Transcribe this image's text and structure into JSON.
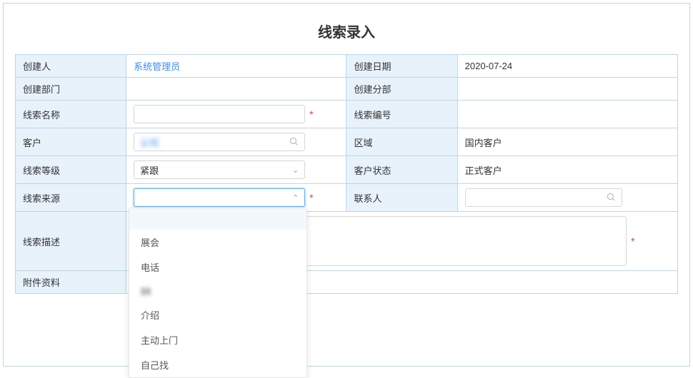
{
  "header": {
    "title": "线索录入"
  },
  "form": {
    "creator": {
      "label": "创建人",
      "value": "系统管理员"
    },
    "createDate": {
      "label": "创建日期",
      "value": "2020-07-24"
    },
    "department": {
      "label": "创建部门",
      "value": ""
    },
    "branch": {
      "label": "创建分部",
      "value": ""
    },
    "leadName": {
      "label": "线索名称",
      "value": ""
    },
    "leadNumber": {
      "label": "线索编号",
      "value": ""
    },
    "customer": {
      "label": "客户",
      "value": "公司"
    },
    "region": {
      "label": "区域",
      "value": "国内客户"
    },
    "leadLevel": {
      "label": "线索等级",
      "value": "紧跟"
    },
    "customerStatus": {
      "label": "客户状态",
      "value": "正式客户"
    },
    "leadSource": {
      "label": "线索来源",
      "value": ""
    },
    "contact": {
      "label": "联系人",
      "value": ""
    },
    "leadDesc": {
      "label": "线索描述",
      "value": ""
    },
    "attachment": {
      "label": "附件资料",
      "value": ""
    }
  },
  "dropdown": {
    "options": [
      "展会",
      "电话",
      "",
      "介绍",
      "主动上门",
      "自己找"
    ]
  }
}
